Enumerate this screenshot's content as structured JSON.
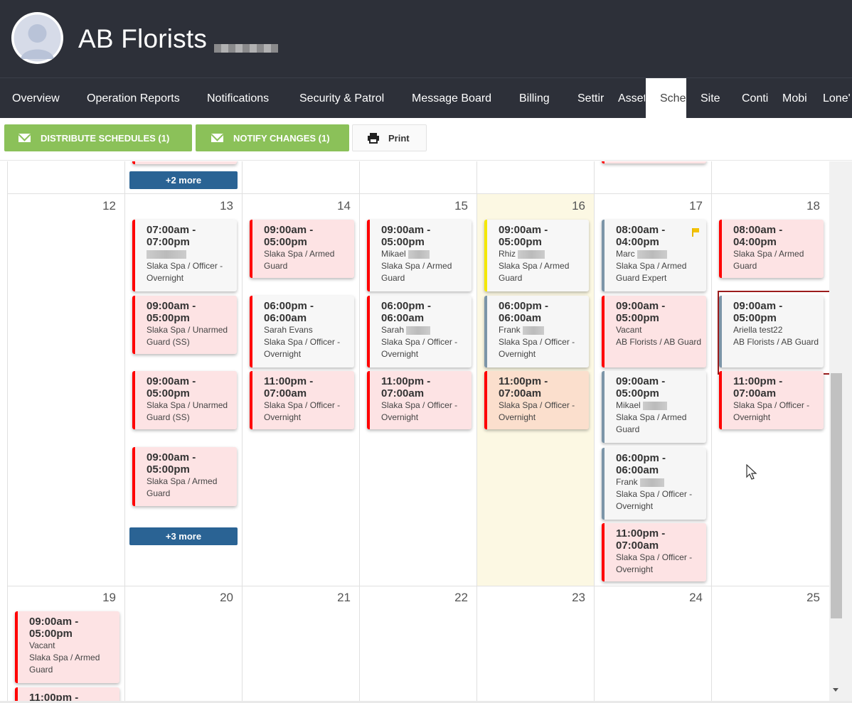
{
  "header": {
    "company": "AB Florists"
  },
  "nav": {
    "items": [
      {
        "label": "Overview"
      },
      {
        "label": "Operation Reports"
      },
      {
        "label": "Notifications"
      },
      {
        "label": "Security & Patrol"
      },
      {
        "label": "Message Board"
      },
      {
        "label": "Billing"
      },
      {
        "label": "Settir"
      },
      {
        "label": "Asset"
      },
      {
        "label": "Sche",
        "active": true
      },
      {
        "label": "Site"
      },
      {
        "label": "Conti"
      },
      {
        "label": "Mobi"
      },
      {
        "label": "Lone'"
      }
    ]
  },
  "toolbar": {
    "distribute": "DISTRIBUTE SCHEDULES (1)",
    "notify": "NOTIFY CHANGES (1)",
    "print": "Print"
  },
  "calendar": {
    "week1_more": "+2 more",
    "week2_days": [
      "12",
      "13",
      "14",
      "15",
      "16",
      "17",
      "18"
    ],
    "week3_days": [
      "19",
      "20",
      "21",
      "22",
      "23",
      "24",
      "25"
    ],
    "week2_more": "+3 more",
    "shifts": [
      {
        "time": "07:00am - 07:00pm",
        "name": "",
        "desc": "Slaka Spa / Officer - Overnight",
        "style": "white"
      },
      {
        "time": "09:00am - 05:00pm",
        "desc": "Slaka Spa / Unarmed Guard (SS)",
        "style": "pink"
      },
      {
        "time": "09:00am - 05:00pm",
        "desc": "Slaka Spa / Unarmed Guard (SS)",
        "style": "pink"
      },
      {
        "time": "09:00am - 05:00pm",
        "desc": "Slaka Spa / Armed Guard",
        "style": "pink"
      },
      {
        "time": "09:00am - 05:00pm",
        "desc": "Slaka Spa / Armed Guard",
        "style": "pink"
      },
      {
        "time": "06:00pm - 06:00am",
        "name": "Sarah Evans",
        "desc": "Slaka Spa / Officer - Overnight",
        "style": "white"
      },
      {
        "time": "11:00pm - 07:00am",
        "desc": "Slaka Spa / Officer - Overnight",
        "style": "pink"
      },
      {
        "time": "09:00am - 05:00pm",
        "name": "Mikael",
        "desc": "Slaka Spa / Armed Guard",
        "style": "white"
      },
      {
        "time": "06:00pm - 06:00am",
        "name": "Sarah",
        "desc": "Slaka Spa / Officer - Overnight",
        "style": "white"
      },
      {
        "time": "11:00pm - 07:00am",
        "desc": "Slaka Spa / Officer - Overnight",
        "style": "pink"
      },
      {
        "time": "09:00am - 05:00pm",
        "name": "Rhiz",
        "desc": "Slaka Spa / Armed Guard",
        "style": "yellow"
      },
      {
        "time": "06:00pm - 06:00am",
        "name": "Frank",
        "desc": "Slaka Spa / Officer - Overnight",
        "style": "gray"
      },
      {
        "time": "11:00pm - 07:00am",
        "desc": "Slaka Spa / Officer - Overnight",
        "style": "orange"
      },
      {
        "time": "08:00am - 04:00pm",
        "name": "Marc",
        "desc": "Slaka Spa / Armed Guard Expert",
        "style": "gray"
      },
      {
        "time": "09:00am - 05:00pm",
        "name": "Vacant",
        "desc": "AB Florists / AB Guard",
        "style": "pink"
      },
      {
        "time": "09:00am - 05:00pm",
        "name": "Mikael",
        "desc": "Slaka Spa / Armed Guard",
        "style": "gray"
      },
      {
        "time": "06:00pm - 06:00am",
        "name": "Frank",
        "desc": "Slaka Spa / Officer - Overnight",
        "style": "gray"
      },
      {
        "time": "11:00pm - 07:00am",
        "desc": "Slaka Spa / Officer - Overnight",
        "style": "pink"
      },
      {
        "time": "08:00am - 04:00pm",
        "desc": "Slaka Spa / Armed Guard",
        "style": "pink"
      },
      {
        "time": "09:00am - 05:00pm",
        "name": "Ariella test22",
        "desc": "AB Florists / AB Guard",
        "style": "gray"
      },
      {
        "time": "11:00pm - 07:00am",
        "desc": "Slaka Spa / Officer - Overnight",
        "style": "pink"
      },
      {
        "time": "09:00am - 05:00pm",
        "name": "Vacant",
        "desc": "Slaka Spa / Armed Guard",
        "style": "pink"
      },
      {
        "time": "11:00pm -",
        "style": "pink"
      }
    ]
  }
}
